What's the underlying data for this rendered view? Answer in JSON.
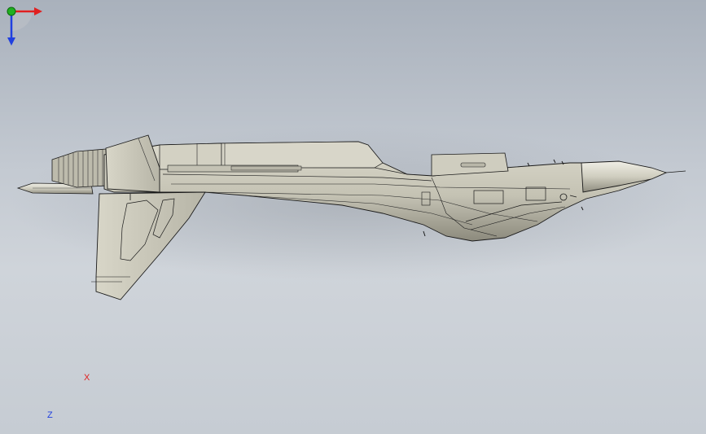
{
  "viewport": {
    "background_top": "#a9b1bc",
    "background_bottom": "#c6ccd3",
    "model_fill": "#c9c7b8",
    "model_shade": "#8f8d80",
    "edge_color": "#1a1a1a"
  },
  "triad": {
    "x_label": "X",
    "z_label": "Z",
    "x_color": "#e02020",
    "y_color": "#20b020",
    "z_color": "#2040e0"
  }
}
